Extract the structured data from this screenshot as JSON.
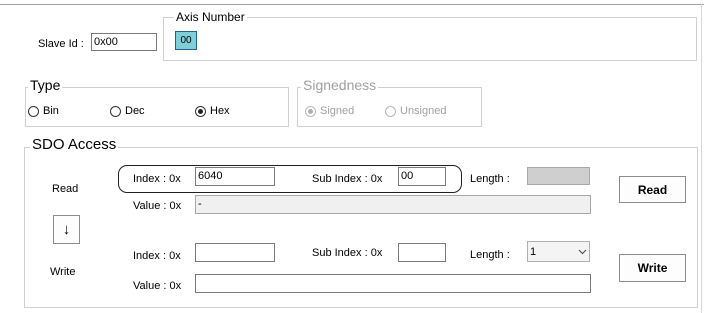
{
  "slave": {
    "label": "Slave Id :",
    "value": "0x00"
  },
  "axis": {
    "legend": "Axis Number",
    "value": "00"
  },
  "type": {
    "legend": "Type",
    "options": [
      {
        "label": "Bin",
        "selected": false
      },
      {
        "label": "Dec",
        "selected": false
      },
      {
        "label": "Hex",
        "selected": true
      }
    ]
  },
  "signedness": {
    "legend": "Signedness",
    "options": [
      {
        "label": "Signed",
        "selected": true
      },
      {
        "label": "Unsigned",
        "selected": false
      }
    ]
  },
  "sdo": {
    "legend": "SDO Access",
    "read_label": "Read",
    "write_label": "Write",
    "arrow_glyph": "↓",
    "read_row": {
      "index_label": "Index : 0x",
      "index_value": "6040",
      "subindex_label": "Sub Index : 0x",
      "subindex_value": "00",
      "length_label": "Length :",
      "length_value": "",
      "value_label": "Value : 0x",
      "value_value": "-"
    },
    "write_row": {
      "index_label": "Index : 0x",
      "index_value": "",
      "subindex_label": "Sub Index : 0x",
      "subindex_value": "",
      "length_label": "Length :",
      "length_value": "1",
      "value_label": "Value : 0x",
      "value_value": ""
    },
    "read_button": "Read",
    "write_button": "Write"
  },
  "colors": {
    "axis_fill": "#7ecfd8",
    "axis_border": "#2a5d8a",
    "disabled_text": "#a0a0a0"
  },
  "icons": {
    "dropdown": "chevron-down-icon",
    "arrow": "arrow-down-icon"
  }
}
